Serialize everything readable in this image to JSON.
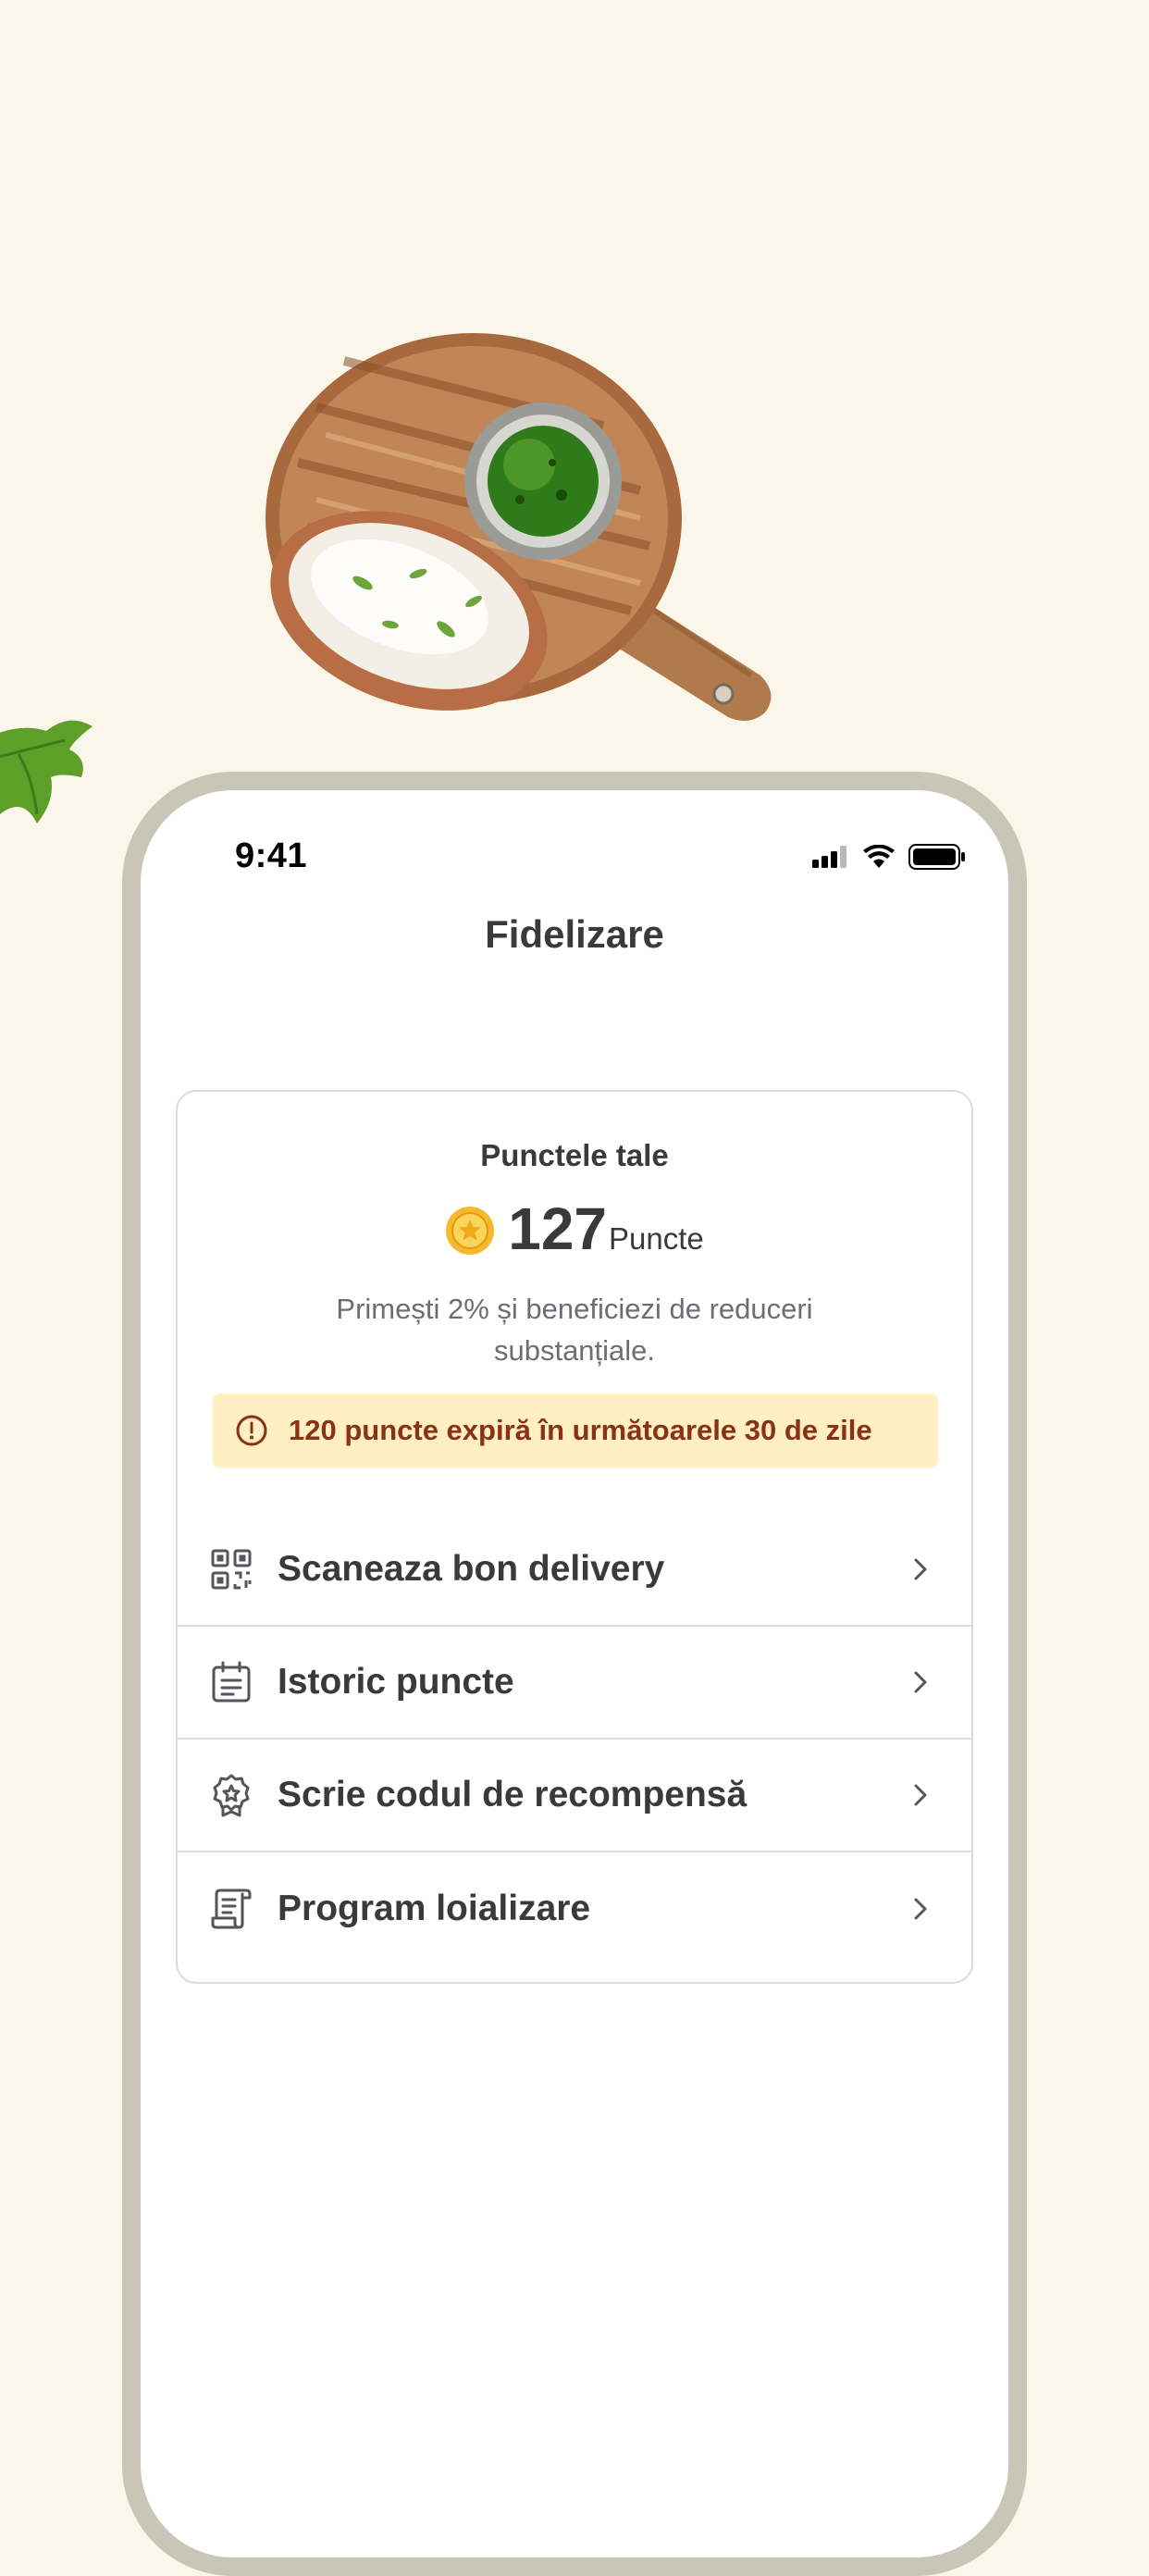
{
  "status_bar": {
    "time": "9:41",
    "icons": [
      "cellular-signal-icon",
      "wifi-icon",
      "battery-icon"
    ]
  },
  "header": {
    "title": "Fidelizare"
  },
  "points_card": {
    "heading": "Punctele tale",
    "coin_icon": "coin-icon",
    "points_value": "127",
    "points_unit": "Puncte",
    "description": "Primești 2% și beneficiezi de reduceri substanțiale.",
    "warning": {
      "icon": "alert-circle-icon",
      "text": "120 puncte expiră în următoarele 30 de zile"
    }
  },
  "menu": {
    "items": [
      {
        "label": "Scaneaza bon delivery",
        "icon": "qr-code-icon"
      },
      {
        "label": "Istoric puncte",
        "icon": "calendar-icon"
      },
      {
        "label": "Scrie codul de recompensă",
        "icon": "award-badge-icon"
      },
      {
        "label": "Program loializare",
        "icon": "receipt-icon"
      }
    ]
  },
  "colors": {
    "background": "#faf6e9",
    "phone_frame": "#c9c6b8",
    "warning_bg": "#ffefc2",
    "warning_text": "#8a3214",
    "coin": "#f5b82e",
    "text_primary": "#3a3a3c",
    "text_secondary": "#6d6d72"
  }
}
